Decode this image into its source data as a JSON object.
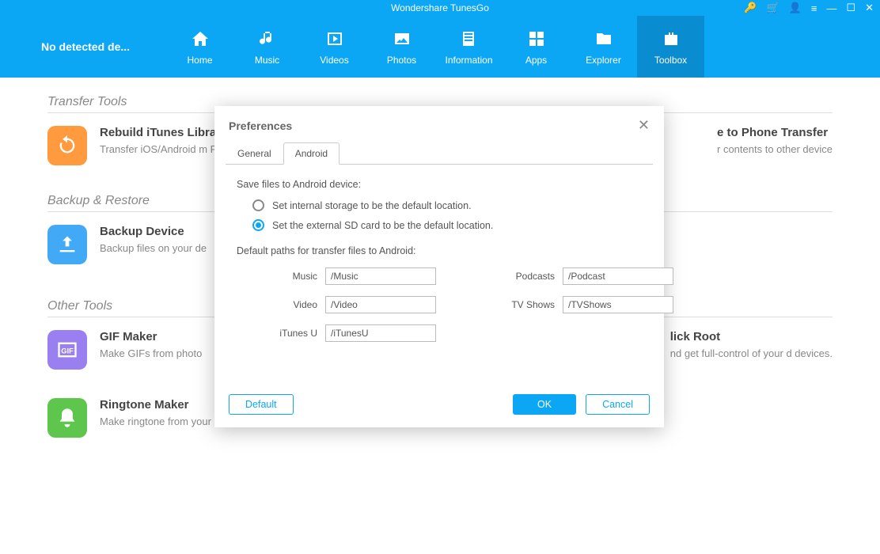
{
  "app": {
    "title": "Wondershare TunesGo",
    "device_status": "No detected de..."
  },
  "nav": {
    "items": [
      {
        "label": "Home"
      },
      {
        "label": "Music"
      },
      {
        "label": "Videos"
      },
      {
        "label": "Photos"
      },
      {
        "label": "Information"
      },
      {
        "label": "Apps"
      },
      {
        "label": "Explorer"
      },
      {
        "label": "Toolbox"
      }
    ]
  },
  "sections": {
    "transfer": {
      "heading": "Transfer Tools",
      "card1": {
        "title": "Rebuild iTunes Libra",
        "desc": "Transfer iOS/Android m\nPlaylists to iTunes"
      },
      "card2": {
        "title": "e to Phone Transfer",
        "desc": "r contents to other device"
      }
    },
    "backup": {
      "heading": "Backup & Restore",
      "card1": {
        "title": "Backup Device",
        "desc": "Backup files on your de"
      }
    },
    "other": {
      "heading": "Other Tools",
      "card1": {
        "title": "GIF Maker",
        "desc": "Make GIFs from photo"
      },
      "card2": {
        "title": "lick Root",
        "desc": "nd get full-control of your\nd devices."
      },
      "card3": {
        "title": "Ringtone Maker",
        "desc": "Make ringtone from your music."
      }
    }
  },
  "dialog": {
    "title": "Preferences",
    "tabs": {
      "general": "General",
      "android": "Android"
    },
    "save_label": "Save files to Android device:",
    "radio1": "Set internal storage to be the default location.",
    "radio2": "Set the external SD card to be the default location.",
    "paths_label": "Default paths for transfer files to Android:",
    "paths": {
      "music": {
        "label": "Music",
        "value": "/Music"
      },
      "video": {
        "label": "Video",
        "value": "/Video"
      },
      "itunesu": {
        "label": "iTunes U",
        "value": "/iTunesU"
      },
      "podcasts": {
        "label": "Podcasts",
        "value": "/Podcast"
      },
      "tvshows": {
        "label": "TV Shows",
        "value": "/TVShows"
      }
    },
    "buttons": {
      "default": "Default",
      "ok": "OK",
      "cancel": "Cancel"
    }
  }
}
